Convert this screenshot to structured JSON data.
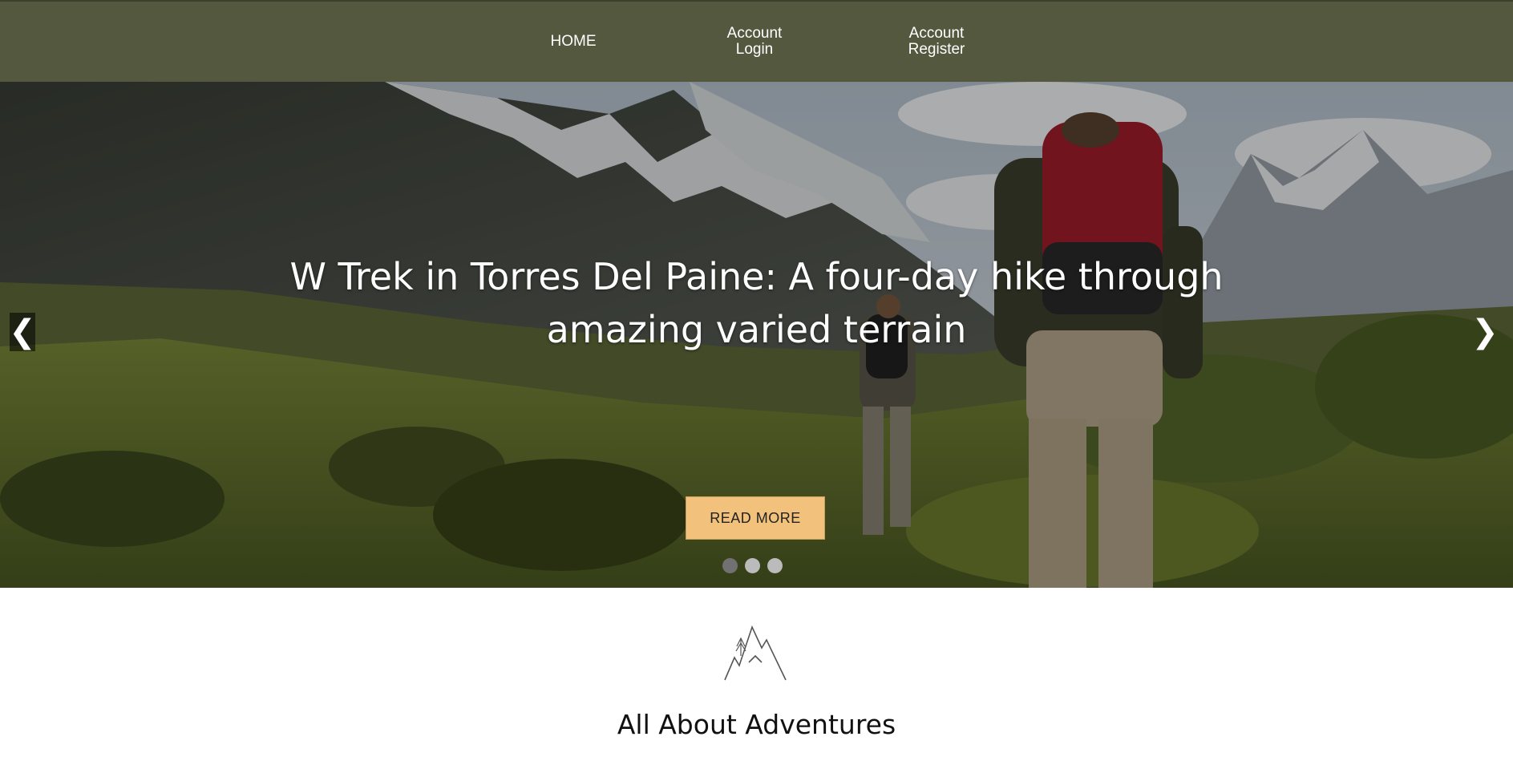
{
  "nav": {
    "home": "HOME",
    "login_line1": "Account",
    "login_line2": "Login",
    "register_line1": "Account",
    "register_line2": "Register"
  },
  "hero": {
    "title": "W Trek in Torres Del Paine: A four-day hike through amazing varied terrain",
    "read_more": "READ MORE",
    "prev_arrow": "❮",
    "next_arrow": "❯",
    "slides_total": 3,
    "active_slide": 1
  },
  "section": {
    "logo_icon": "mountain-icon",
    "title": "All About Adventures"
  },
  "colors": {
    "nav_bg": "#54583f",
    "button_bg": "#f2c27c",
    "dot_active": "#717171",
    "dot_inactive": "#bbbbbb"
  }
}
